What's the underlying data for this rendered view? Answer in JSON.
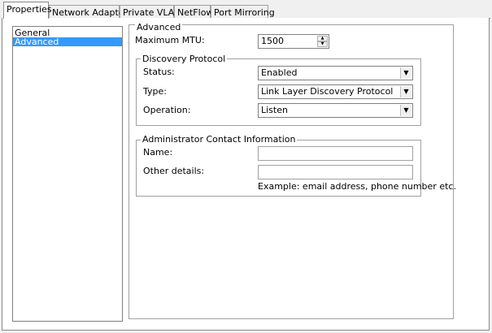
{
  "tabs": [
    {
      "label": "Properties",
      "active": true
    },
    {
      "label": "Network Adapters",
      "active": false
    },
    {
      "label": "Private VLAN",
      "active": false
    },
    {
      "label": "NetFlow",
      "active": false
    },
    {
      "label": "Port Mirroring",
      "active": false
    }
  ],
  "sidebar": {
    "items": [
      {
        "label": "General",
        "selected": false
      },
      {
        "label": "Advanced",
        "selected": true
      }
    ]
  },
  "advanced": {
    "title": "Advanced",
    "mtu": {
      "label": "Maximum MTU:",
      "value": "1500"
    },
    "discovery": {
      "title": "Discovery Protocol",
      "status": {
        "label": "Status:",
        "value": "Enabled"
      },
      "type": {
        "label": "Type:",
        "value": "Link Layer Discovery Protocol"
      },
      "operation": {
        "label": "Operation:",
        "value": "Listen"
      }
    },
    "contact": {
      "title": "Administrator Contact Information",
      "name": {
        "label": "Name:",
        "value": ""
      },
      "other": {
        "label": "Other details:",
        "value": ""
      },
      "hint": "Example: email address, phone number etc."
    }
  },
  "colors": {
    "selection": "#3399ff"
  }
}
